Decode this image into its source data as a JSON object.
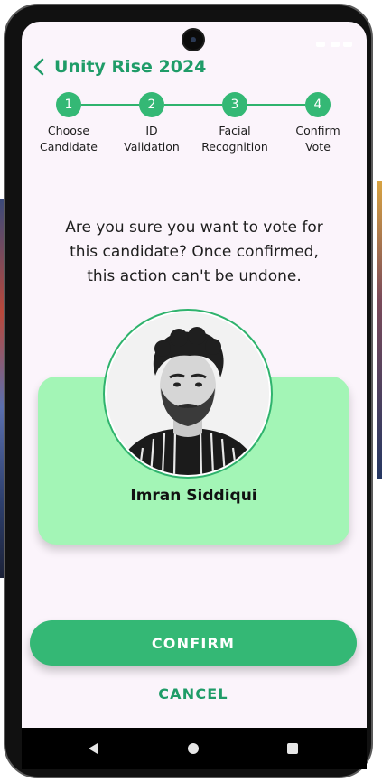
{
  "app": {
    "title": "Unity Rise 2024"
  },
  "stepper": {
    "steps": [
      {
        "number": "1",
        "label_line1": "Choose",
        "label_line2": "Candidate"
      },
      {
        "number": "2",
        "label_line1": "ID",
        "label_line2": "Validation"
      },
      {
        "number": "3",
        "label_line1": "Facial",
        "label_line2": "Recognition"
      },
      {
        "number": "4",
        "label_line1": "Confirm",
        "label_line2": "Vote"
      }
    ]
  },
  "confirmation": {
    "question_line1": "Are you sure you want to vote for",
    "question_line2": "this candidate? Once confirmed,",
    "question_line3": "this action can't be undone."
  },
  "candidate": {
    "name": "Imran Siddiqui"
  },
  "actions": {
    "confirm_label": "CONFIRM",
    "cancel_label": "CANCEL"
  },
  "colors": {
    "accent": "#34b875",
    "accent_text": "#1f9c68",
    "card_bg": "#a3f5b6",
    "screen_bg": "#fbf4fb"
  },
  "icons": {
    "back": "chevron-left-icon",
    "nav_back": "triangle-back-icon",
    "nav_home": "circle-home-icon",
    "nav_recents": "square-recents-icon"
  }
}
